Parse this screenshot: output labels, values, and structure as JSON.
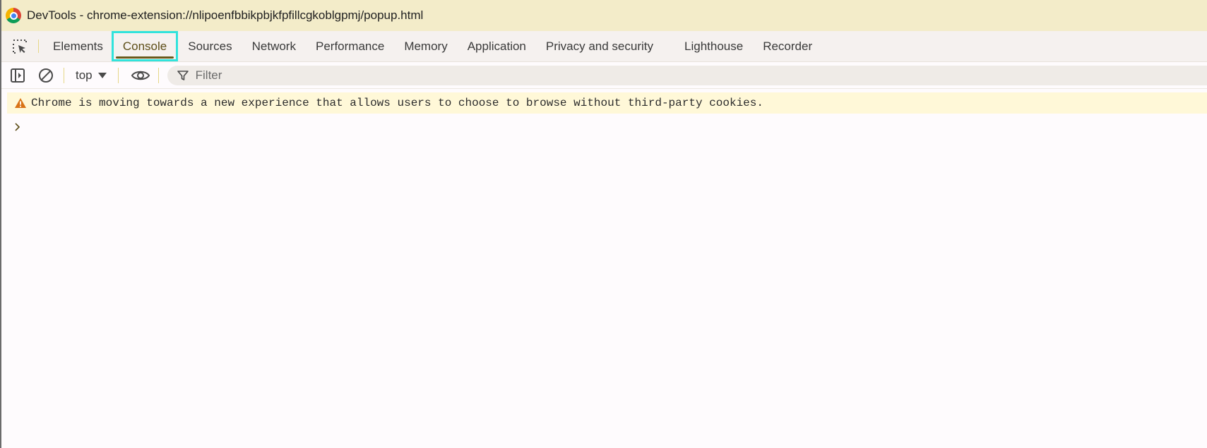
{
  "window": {
    "title": "DevTools - chrome-extension://nlipoenfbbikpbjkfpfillcgkoblgpmj/popup.html",
    "logo_icon": "chrome-logo-icon"
  },
  "tabs": [
    {
      "label": "Elements",
      "active": false
    },
    {
      "label": "Console",
      "active": true
    },
    {
      "label": "Sources",
      "active": false
    },
    {
      "label": "Network",
      "active": false
    },
    {
      "label": "Performance",
      "active": false
    },
    {
      "label": "Memory",
      "active": false
    },
    {
      "label": "Application",
      "active": false
    },
    {
      "label": "Privacy and security",
      "active": false
    },
    {
      "label": "Lighthouse",
      "active": false
    },
    {
      "label": "Recorder",
      "active": false
    }
  ],
  "toolbar": {
    "context": "top",
    "filter_placeholder": "Filter",
    "filter_value": ""
  },
  "console": {
    "warning": "Chrome is moving towards a new experience that allows users to choose to browse without third-party cookies."
  },
  "colors": {
    "title_bar": "#f3ecc9",
    "active_tab_outline": "#31e3dc",
    "warning_bg": "#fff8d8",
    "warning_icon": "#e37400"
  }
}
